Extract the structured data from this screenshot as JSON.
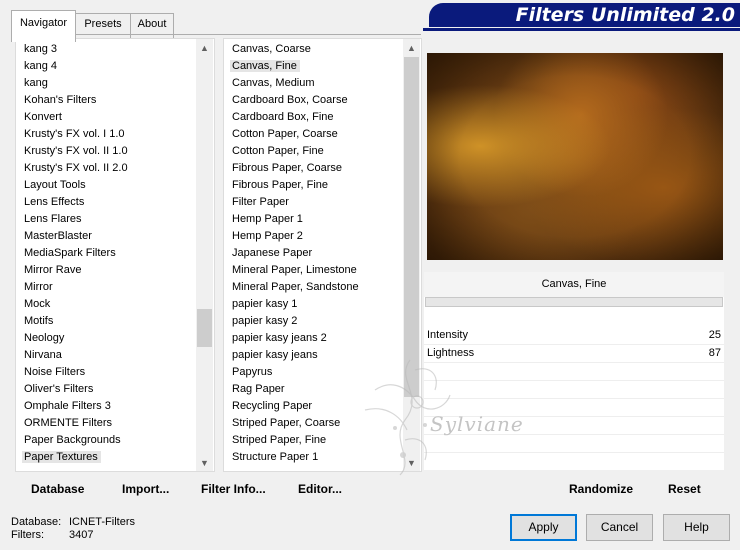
{
  "tabs": [
    {
      "label": "Navigator",
      "active": true
    },
    {
      "label": "Presets",
      "active": false
    },
    {
      "label": "About",
      "active": false
    }
  ],
  "banner": {
    "title": "Filters Unlimited 2.0",
    "color": "#0a1a7c"
  },
  "categories": {
    "items": [
      "kang 3",
      "kang 4",
      "kang",
      "Kohan's Filters",
      "Konvert",
      "Krusty's FX vol. I 1.0",
      "Krusty's FX vol. II 1.0",
      "Krusty's FX vol. II 2.0",
      "Layout Tools",
      "Lens Effects",
      "Lens Flares",
      "MasterBlaster",
      "MediaSpark Filters",
      "Mirror Rave",
      "Mirror",
      "Mock",
      "Motifs",
      "Neology",
      "Nirvana",
      "Noise Filters",
      "Oliver's Filters",
      "Omphale Filters 3",
      "ORMENTE Filters",
      "Paper Backgrounds",
      "Paper Textures"
    ],
    "selected_index": 24
  },
  "filters": {
    "items": [
      "Canvas, Coarse",
      "Canvas, Fine",
      "Canvas, Medium",
      "Cardboard Box, Coarse",
      "Cardboard Box, Fine",
      "Cotton Paper, Coarse",
      "Cotton Paper, Fine",
      "Fibrous Paper, Coarse",
      "Fibrous Paper, Fine",
      "Filter Paper",
      "Hemp Paper 1",
      "Hemp Paper 2",
      "Japanese Paper",
      "Mineral Paper, Limestone",
      "Mineral Paper, Sandstone",
      "papier kasy 1",
      "papier kasy 2",
      "papier kasy jeans 2",
      "papier kasy jeans",
      "Papyrus",
      "Rag Paper",
      "Recycling Paper",
      "Striped Paper, Coarse",
      "Striped Paper, Fine",
      "Structure Paper 1"
    ],
    "selected_index": 1
  },
  "left_buttons": [
    {
      "label": "Database"
    },
    {
      "label": "Import..."
    },
    {
      "label": "Filter Info..."
    },
    {
      "label": "Editor..."
    }
  ],
  "filter_panel": {
    "name": "Canvas, Fine",
    "params": [
      {
        "label": "Intensity",
        "value": "25"
      },
      {
        "label": "Lightness",
        "value": "87"
      }
    ]
  },
  "right_buttons": {
    "randomize": "Randomize",
    "reset": "Reset"
  },
  "status": {
    "database_label": "Database:",
    "database_value": "ICNET-Filters",
    "filters_label": "Filters:",
    "filters_value": "3407"
  },
  "dialog_buttons": {
    "apply": "Apply",
    "cancel": "Cancel",
    "help": "Help"
  },
  "watermark": "Sylviane"
}
